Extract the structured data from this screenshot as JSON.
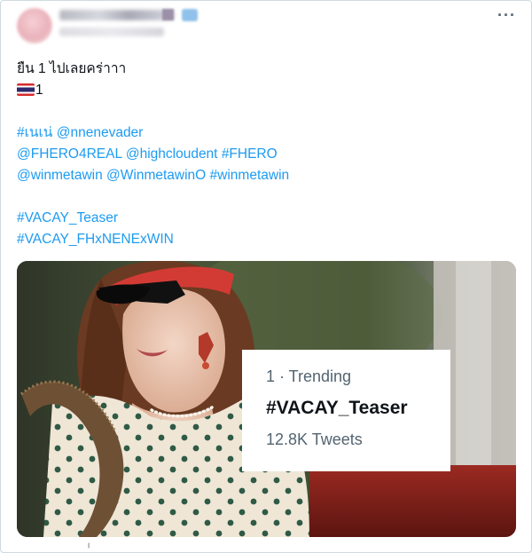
{
  "tweet": {
    "more_icon": "ellipsis-icon",
    "avatar": "avatar-blurred",
    "verified_icon": "verified-badge-icon",
    "text_line1": "ยืน 1 ไปเลยคร่าาา",
    "flag_emoji": "thailand-flag-icon",
    "text_line2_suffix": "1",
    "hashtags_line1": [
      {
        "text": "#เนเน่",
        "kind": "hashtag"
      },
      {
        "text": " ",
        "kind": "space"
      },
      {
        "text": "@nnenevader",
        "kind": "mention"
      }
    ],
    "hashtags_line2": [
      {
        "text": "@FHERO4REAL",
        "kind": "mention"
      },
      {
        "text": " ",
        "kind": "space"
      },
      {
        "text": "@highcloudent",
        "kind": "mention"
      },
      {
        "text": " ",
        "kind": "space"
      },
      {
        "text": "#FHERO",
        "kind": "hashtag"
      }
    ],
    "hashtags_line3": [
      {
        "text": "@winmetawin",
        "kind": "mention"
      },
      {
        "text": " ",
        "kind": "space"
      },
      {
        "text": "@WinmetawinO",
        "kind": "mention"
      },
      {
        "text": " ",
        "kind": "space"
      },
      {
        "text": "#winmetawin",
        "kind": "hashtag"
      }
    ],
    "hashtag_teaser": "#VACAY_Teaser",
    "hashtag_collab": "#VACAY_FHxNENExWIN",
    "link_color": "#1d9bf0"
  },
  "media": {
    "trend_rank": "1 · Trending",
    "trend_tag": "#VACAY_Teaser",
    "trend_count": "12.8K Tweets"
  }
}
